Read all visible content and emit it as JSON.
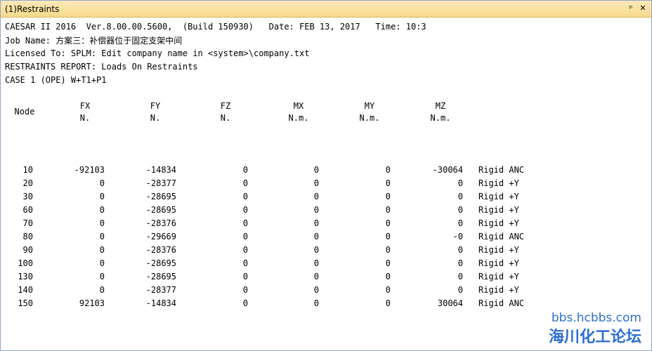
{
  "window": {
    "title": "(1)Restraints",
    "pin_glyph": "ᵖ",
    "close_glyph": "✕"
  },
  "report": {
    "line1": "CAESAR II 2016  Ver.8.00.00.5600,  (Build 150930)   Date: FEB 13, 2017   Time: 10:3",
    "line2": "Job Name: 方案三：补偿器位于固定支架中间",
    "line3": "Licensed To: SPLM: Edit company name in <system>\\company.txt",
    "line4": "RESTRAINTS REPORT: Loads On Restraints",
    "line5": "CASE 1 (OPE) W+T1+P1"
  },
  "columns": [
    {
      "key": "node",
      "label": "Node",
      "unit": ""
    },
    {
      "key": "fx",
      "label": "FX",
      "unit": "N."
    },
    {
      "key": "fy",
      "label": "FY",
      "unit": "N."
    },
    {
      "key": "fz",
      "label": "FZ",
      "unit": "N."
    },
    {
      "key": "mx",
      "label": "MX",
      "unit": "N.m."
    },
    {
      "key": "my",
      "label": "MY",
      "unit": "N.m."
    },
    {
      "key": "mz",
      "label": "MZ",
      "unit": "N.m."
    }
  ],
  "rows": [
    {
      "node": "10",
      "fx": "-92103",
      "fy": "-14834",
      "fz": "0",
      "mx": "0",
      "my": "0",
      "mz": "-30064",
      "type": "Rigid ANC"
    },
    {
      "node": "20",
      "fx": "0",
      "fy": "-28377",
      "fz": "0",
      "mx": "0",
      "my": "0",
      "mz": "0",
      "type": "Rigid +Y"
    },
    {
      "node": "30",
      "fx": "0",
      "fy": "-28695",
      "fz": "0",
      "mx": "0",
      "my": "0",
      "mz": "0",
      "type": "Rigid +Y"
    },
    {
      "node": "60",
      "fx": "0",
      "fy": "-28695",
      "fz": "0",
      "mx": "0",
      "my": "0",
      "mz": "0",
      "type": "Rigid +Y"
    },
    {
      "node": "70",
      "fx": "0",
      "fy": "-28376",
      "fz": "0",
      "mx": "0",
      "my": "0",
      "mz": "0",
      "type": "Rigid +Y"
    },
    {
      "node": "80",
      "fx": "0",
      "fy": "-29669",
      "fz": "0",
      "mx": "0",
      "my": "0",
      "mz": "-0",
      "type": "Rigid ANC"
    },
    {
      "node": "90",
      "fx": "0",
      "fy": "-28376",
      "fz": "0",
      "mx": "0",
      "my": "0",
      "mz": "0",
      "type": "Rigid +Y"
    },
    {
      "node": "100",
      "fx": "0",
      "fy": "-28695",
      "fz": "0",
      "mx": "0",
      "my": "0",
      "mz": "0",
      "type": "Rigid +Y"
    },
    {
      "node": "130",
      "fx": "0",
      "fy": "-28695",
      "fz": "0",
      "mx": "0",
      "my": "0",
      "mz": "0",
      "type": "Rigid +Y"
    },
    {
      "node": "140",
      "fx": "0",
      "fy": "-28377",
      "fz": "0",
      "mx": "0",
      "my": "0",
      "mz": "0",
      "type": "Rigid +Y"
    },
    {
      "node": "150",
      "fx": "92103",
      "fy": "-14834",
      "fz": "0",
      "mx": "0",
      "my": "0",
      "mz": "30064",
      "type": "Rigid ANC"
    }
  ],
  "watermark": {
    "url": "bbs.hcbbs.com",
    "name": "海川化工论坛"
  }
}
